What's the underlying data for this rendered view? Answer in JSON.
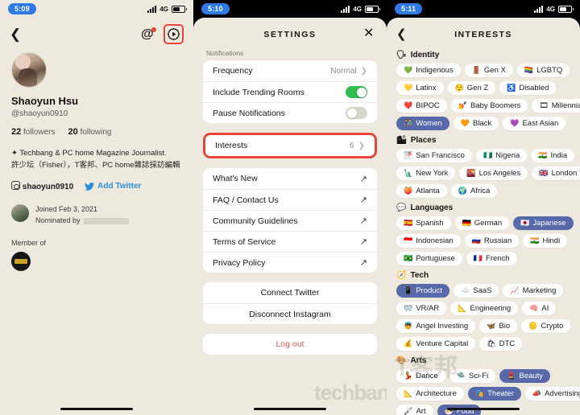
{
  "profile_screen": {
    "statusbar": {
      "time": "5:09",
      "network": "4G"
    },
    "nav": {
      "back_icon": "back-chevron-icon",
      "mentions_icon": "at-mention-icon",
      "settings_icon": "gear-icon"
    },
    "name": "Shaoyun Hsu",
    "handle": "@shaoyun0910",
    "followers_count": "22",
    "followers_label": "followers",
    "following_count": "20",
    "following_label": "following",
    "bio_line1": "✦ Techbang & PC home Magazine Journalist.",
    "bio_line2": "許少坛（Fisher），T客邦、PC home雜誌採訪編輯",
    "instagram_handle": "shaoyun0910",
    "add_twitter_label": "Add Twitter",
    "joined_text": "Joined Feb 3, 2021",
    "nominated_label": "Nominated by",
    "member_of_label": "Member of"
  },
  "settings_screen": {
    "statusbar": {
      "time": "5:10",
      "network": "4G"
    },
    "title": "SETTINGS",
    "close_label": "✕",
    "notifications_section_label": "Notifications",
    "rows": [
      {
        "label": "Frequency",
        "value": "Normal",
        "control": "chevron"
      },
      {
        "label": "Include Trending Rooms",
        "value": "",
        "control": "toggle-on"
      },
      {
        "label": "Pause Notifications",
        "value": "",
        "control": "toggle-off"
      }
    ],
    "interests_row": {
      "label": "Interests",
      "value": "6",
      "control": "chevron",
      "highlighted": true
    },
    "links": [
      {
        "label": "What's New"
      },
      {
        "label": "FAQ / Contact Us"
      },
      {
        "label": "Community Guidelines"
      },
      {
        "label": "Terms of Service"
      },
      {
        "label": "Privacy Policy"
      }
    ],
    "account_actions": [
      {
        "label": "Connect Twitter"
      },
      {
        "label": "Disconnect Instagram"
      }
    ],
    "logout_label": "Log out"
  },
  "interests_screen": {
    "statusbar": {
      "time": "5:11",
      "network": "4G"
    },
    "title": "INTERESTS",
    "back_icon": "back-chevron-icon",
    "groups": [
      {
        "name": "Identity",
        "emoji": "🗣",
        "chips": [
          {
            "emoji": "💚",
            "label": "Indigenous",
            "selected": false
          },
          {
            "emoji": "🚪",
            "label": "Gen X",
            "selected": false
          },
          {
            "emoji": "🏳️‍🌈",
            "label": "LGBTQ",
            "selected": false
          },
          {
            "emoji": "💛",
            "label": "Latinx",
            "selected": false
          },
          {
            "emoji": "😌",
            "label": "Gen Z",
            "selected": false
          },
          {
            "emoji": "♿",
            "label": "Disabled",
            "selected": false
          },
          {
            "emoji": "❤️",
            "label": "BIPOC",
            "selected": false
          },
          {
            "emoji": "💅",
            "label": "Baby Boomers",
            "selected": false
          },
          {
            "emoji": "🎞",
            "label": "Millennials",
            "selected": false
          },
          {
            "emoji": "👫",
            "label": "Women",
            "selected": true
          },
          {
            "emoji": "🧡",
            "label": "Black",
            "selected": false
          },
          {
            "emoji": "💜",
            "label": "East Asian",
            "selected": false
          }
        ]
      },
      {
        "name": "Places",
        "emoji": "🏙",
        "chips": [
          {
            "emoji": "🌁",
            "label": "San Francisco",
            "selected": false
          },
          {
            "emoji": "🇳🇬",
            "label": "Nigeria",
            "selected": false
          },
          {
            "emoji": "🇮🇳",
            "label": "India",
            "selected": false
          },
          {
            "emoji": "🗽",
            "label": "New York",
            "selected": false
          },
          {
            "emoji": "🌇",
            "label": "Los Angeles",
            "selected": false
          },
          {
            "emoji": "🇬🇧",
            "label": "London",
            "selected": false
          },
          {
            "emoji": "🍑",
            "label": "Atlanta",
            "selected": false
          },
          {
            "emoji": "🌍",
            "label": "Africa",
            "selected": false
          }
        ]
      },
      {
        "name": "Languages",
        "emoji": "💬",
        "chips": [
          {
            "emoji": "🇪🇸",
            "label": "Spanish",
            "selected": false
          },
          {
            "emoji": "🇩🇪",
            "label": "German",
            "selected": false
          },
          {
            "emoji": "🇯🇵",
            "label": "Japanese",
            "selected": true
          },
          {
            "emoji": "🇮🇩",
            "label": "Indonesian",
            "selected": false
          },
          {
            "emoji": "🇷🇺",
            "label": "Russian",
            "selected": false
          },
          {
            "emoji": "🇮🇳",
            "label": "Hindi",
            "selected": false
          },
          {
            "emoji": "🇧🇷",
            "label": "Portuguese",
            "selected": false
          },
          {
            "emoji": "🇫🇷",
            "label": "French",
            "selected": false
          }
        ]
      },
      {
        "name": "Tech",
        "emoji": "🧭",
        "chips": [
          {
            "emoji": "📱",
            "label": "Product",
            "selected": true
          },
          {
            "emoji": "☁️",
            "label": "SaaS",
            "selected": false
          },
          {
            "emoji": "📈",
            "label": "Marketing",
            "selected": false
          },
          {
            "emoji": "🥽",
            "label": "VR/AR",
            "selected": false
          },
          {
            "emoji": "📐",
            "label": "Engineering",
            "selected": false
          },
          {
            "emoji": "🧠",
            "label": "AI",
            "selected": false
          },
          {
            "emoji": "👼",
            "label": "Angel Investing",
            "selected": false
          },
          {
            "emoji": "🦋",
            "label": "Bio",
            "selected": false
          },
          {
            "emoji": "🪙",
            "label": "Crypto",
            "selected": false
          },
          {
            "emoji": "💰",
            "label": "Venture Capital",
            "selected": false
          },
          {
            "emoji": "🛍",
            "label": "DTC",
            "selected": false
          }
        ]
      },
      {
        "name": "Arts",
        "emoji": "🎨",
        "chips": [
          {
            "emoji": "💃",
            "label": "Dance",
            "selected": false
          },
          {
            "emoji": "🛸",
            "label": "Sci-Fi",
            "selected": false
          },
          {
            "emoji": "💄",
            "label": "Beauty",
            "selected": true
          },
          {
            "emoji": "📐",
            "label": "Architecture",
            "selected": false
          },
          {
            "emoji": "🎭",
            "label": "Theater",
            "selected": true
          },
          {
            "emoji": "📣",
            "label": "Advertising",
            "selected": false
          },
          {
            "emoji": "🖌",
            "label": "Art",
            "selected": false
          },
          {
            "emoji": "🍜",
            "label": "Food",
            "selected": true
          }
        ]
      }
    ]
  },
  "watermark": {
    "text1": "techbang",
    "text2": "T客邦"
  },
  "colors": {
    "background": "#ede9de",
    "card": "#ffffff",
    "accent_selected": "#5769a9",
    "toggle_on": "#2fbe4f",
    "highlight_box": "#e8443a",
    "logout": "#e25b53",
    "link_blue": "#2d8fd6"
  }
}
